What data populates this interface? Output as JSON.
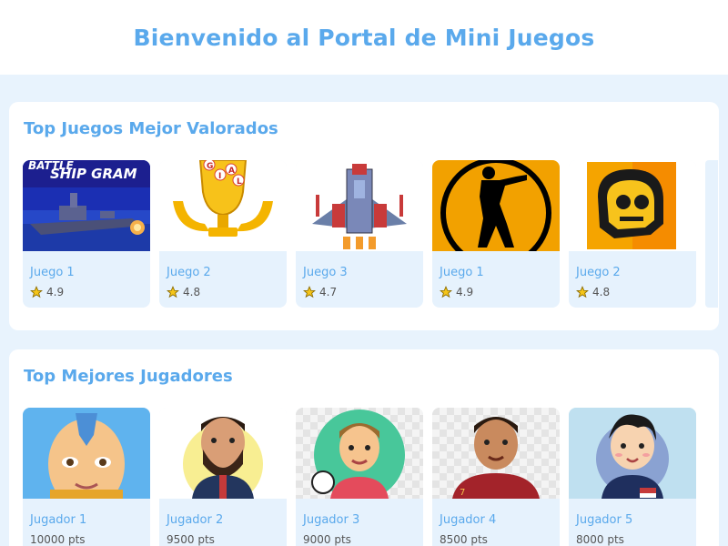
{
  "header": {
    "title": "Bienvenido al Portal de Mini Juegos"
  },
  "games": {
    "title": "Top Juegos Mejor Valorados",
    "items": [
      {
        "name": "Juego 1",
        "rating": "4.9",
        "thumb_text": "SHIP GRAM",
        "thumb_top_text": "BATTLE"
      },
      {
        "name": "Juego 2",
        "rating": "4.8",
        "thumb_letters": [
          "G",
          "I",
          "A",
          "L"
        ]
      },
      {
        "name": "Juego 3",
        "rating": "4.7"
      },
      {
        "name": "Juego 1",
        "rating": "4.9"
      },
      {
        "name": "Juego 2",
        "rating": "4.8"
      }
    ]
  },
  "players": {
    "title": "Top Mejores Jugadores",
    "items": [
      {
        "name": "Jugador 1",
        "score": "10000 pts"
      },
      {
        "name": "Jugador 2",
        "score": "9500 pts"
      },
      {
        "name": "Jugador 3",
        "score": "9000 pts"
      },
      {
        "name": "Jugador 4",
        "score": "8500 pts"
      },
      {
        "name": "Jugador 5",
        "score": "8000 pts"
      }
    ]
  },
  "icons": {
    "rating": "star-icon"
  },
  "colors": {
    "accent": "#5aa9ec",
    "page_bg": "#e8f3fd",
    "card_bg": "#e6f2fd",
    "star": "#f5c518"
  }
}
